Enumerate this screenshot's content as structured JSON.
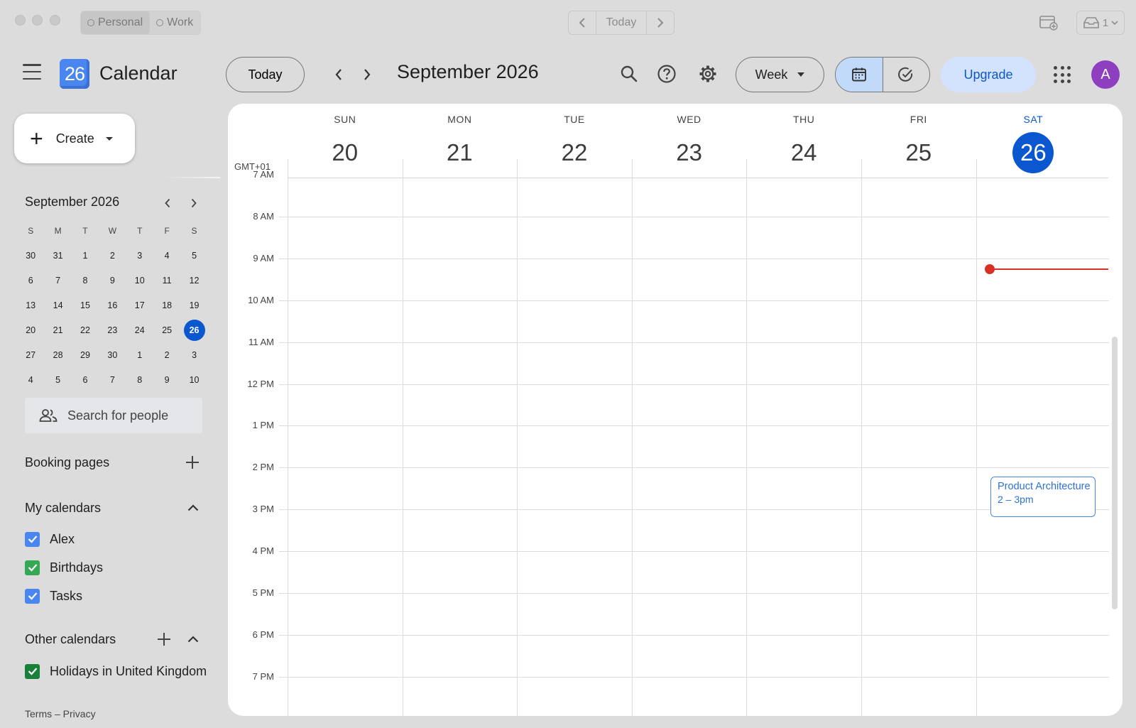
{
  "titlebar": {
    "profiles": [
      {
        "label": "Personal",
        "active": true
      },
      {
        "label": "Work",
        "active": false
      }
    ],
    "nav_today": "Today",
    "inbox_count": "1"
  },
  "header": {
    "app_title": "Calendar",
    "logo_text": "26",
    "today_button": "Today",
    "period": "September 2026",
    "view": "Week",
    "upgrade": "Upgrade",
    "avatar_initial": "A"
  },
  "sidebar": {
    "create_label": "Create",
    "mini_calendar": {
      "title": "September 2026",
      "weekdays": [
        "S",
        "M",
        "T",
        "W",
        "T",
        "F",
        "S"
      ],
      "weeks": [
        [
          "30",
          "31",
          "1",
          "2",
          "3",
          "4",
          "5"
        ],
        [
          "6",
          "7",
          "8",
          "9",
          "10",
          "11",
          "12"
        ],
        [
          "13",
          "14",
          "15",
          "16",
          "17",
          "18",
          "19"
        ],
        [
          "20",
          "21",
          "22",
          "23",
          "24",
          "25",
          "26"
        ],
        [
          "27",
          "28",
          "29",
          "30",
          "1",
          "2",
          "3"
        ],
        [
          "4",
          "5",
          "6",
          "7",
          "8",
          "9",
          "10"
        ]
      ],
      "today": "26"
    },
    "search_people_placeholder": "Search for people",
    "booking_pages": "Booking pages",
    "my_calendars": {
      "title": "My calendars",
      "items": [
        {
          "label": "Alex",
          "color": "#4a86ef"
        },
        {
          "label": "Birthdays",
          "color": "#34a853"
        },
        {
          "label": "Tasks",
          "color": "#4a86ef"
        }
      ]
    },
    "other_calendars": {
      "title": "Other calendars",
      "items": [
        {
          "label": "Holidays in United Kingdom",
          "color": "#188038"
        }
      ]
    },
    "footer": "Terms – Privacy"
  },
  "week": {
    "timezone": "GMT+01",
    "days": [
      {
        "dow": "SUN",
        "num": "20",
        "today": false
      },
      {
        "dow": "MON",
        "num": "21",
        "today": false
      },
      {
        "dow": "TUE",
        "num": "22",
        "today": false
      },
      {
        "dow": "WED",
        "num": "23",
        "today": false
      },
      {
        "dow": "THU",
        "num": "24",
        "today": false
      },
      {
        "dow": "FRI",
        "num": "25",
        "today": false
      },
      {
        "dow": "SAT",
        "num": "26",
        "today": true
      }
    ],
    "hours": [
      "7 AM",
      "8 AM",
      "9 AM",
      "10 AM",
      "11 AM",
      "12 PM",
      "1 PM",
      "2 PM",
      "3 PM",
      "4 PM",
      "5 PM",
      "6 PM",
      "7 PM"
    ],
    "events": [
      {
        "title": "Product Architecture",
        "time": "2 – 3pm",
        "day": "SAT"
      }
    ]
  },
  "colors": {
    "accent": "#0b57d0",
    "now_line": "#d93025",
    "event_border": "#4a86ef"
  }
}
